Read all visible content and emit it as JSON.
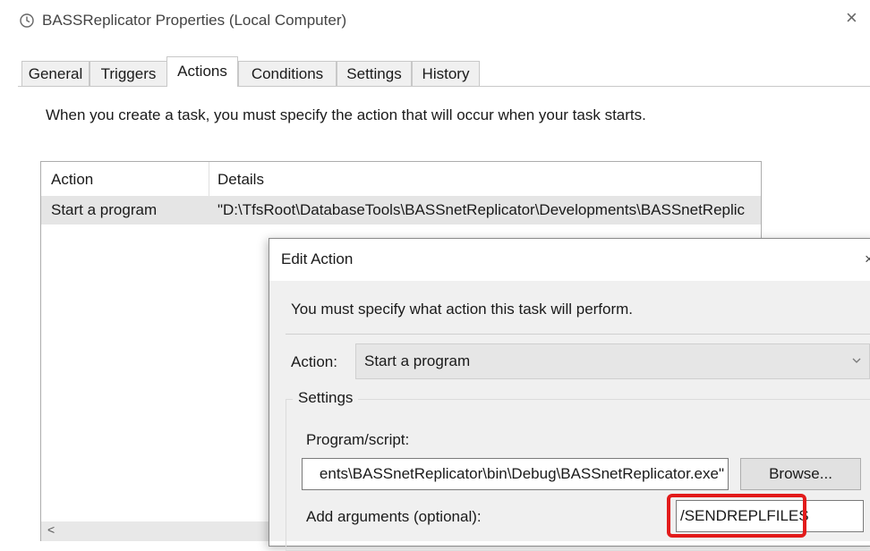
{
  "window": {
    "title": "BASSReplicator Properties (Local Computer)",
    "close_glyph": "×"
  },
  "tabs": [
    {
      "label": "General"
    },
    {
      "label": "Triggers"
    },
    {
      "label": "Actions",
      "active": true
    },
    {
      "label": "Conditions"
    },
    {
      "label": "Settings"
    },
    {
      "label": "History"
    }
  ],
  "actions_tab": {
    "description": "When you create a task, you must specify the action that will occur when your task starts.",
    "columns": {
      "action": "Action",
      "details": "Details"
    },
    "rows": [
      {
        "action": "Start a program",
        "details": "\"D:\\TfsRoot\\DatabaseTools\\BASSnetReplicator\\Developments\\BASSnetReplic"
      }
    ],
    "scroll_left_glyph": "<"
  },
  "edit_action": {
    "title": "Edit Action",
    "close_glyph": "×",
    "message": "You must specify what action this task will perform.",
    "action_label": "Action:",
    "action_value": "Start a program",
    "settings_label": "Settings",
    "program_label": "Program/script:",
    "program_value": "ents\\BASSnetReplicator\\bin\\Debug\\BASSnetReplicator.exe\"",
    "browse_label": "Browse...",
    "args_label": "Add arguments (optional):",
    "args_value": "/SENDREPLFILES"
  },
  "icons": {
    "app": "clock-icon",
    "dropdown": "chevron-down-icon"
  },
  "colors": {
    "highlight": "#e21b1b",
    "selected_row": "#e5e5e5",
    "dialog_body": "#f0f0f0"
  }
}
